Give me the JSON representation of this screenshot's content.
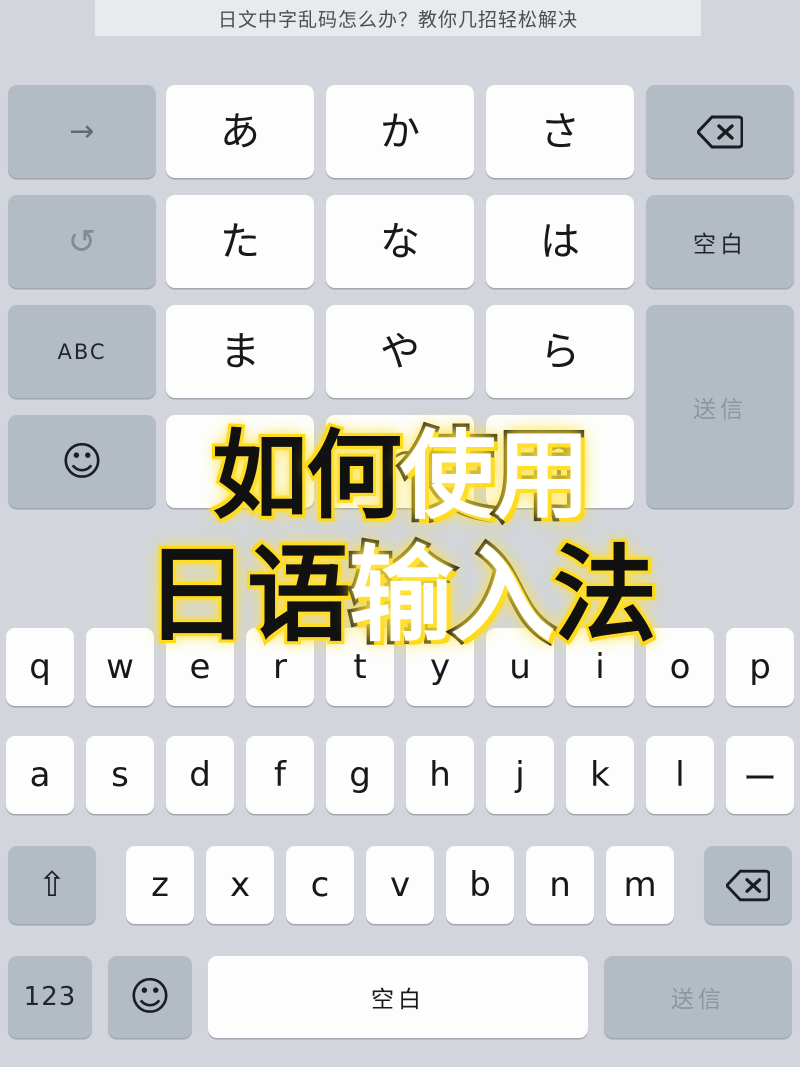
{
  "header": {
    "title": "日文中字乱码怎么办？教你几招轻松解决"
  },
  "overlay_art": {
    "line1": [
      {
        "char": "如",
        "style": "black"
      },
      {
        "char": "何",
        "style": "black"
      },
      {
        "char": "使",
        "style": "white"
      },
      {
        "char": "用",
        "style": "white"
      }
    ],
    "line2": [
      {
        "char": "日",
        "style": "black"
      },
      {
        "char": "语",
        "style": "black"
      },
      {
        "char": "输",
        "style": "white"
      },
      {
        "char": "入",
        "style": "white"
      },
      {
        "char": "法",
        "style": "black"
      }
    ],
    "glow_color": "#ffd400",
    "fill_black": "#111111",
    "fill_white": "#ffffff"
  },
  "kana_keyboard": {
    "left_column": [
      {
        "name": "arrow-right-key",
        "label": "→",
        "type": "gray"
      },
      {
        "name": "undo-key",
        "label": "↺",
        "type": "gray"
      },
      {
        "name": "abc-mode-key",
        "label": "ABC",
        "type": "gray"
      },
      {
        "name": "emoji-key",
        "label": "☺",
        "type": "gray"
      }
    ],
    "kana_grid": [
      [
        "あ",
        "か",
        "さ"
      ],
      [
        "た",
        "な",
        "は"
      ],
      [
        "ま",
        "や",
        "ら"
      ],
      [
        "、",
        "わ",
        "?"
      ]
    ],
    "right_column": [
      {
        "name": "delete-key",
        "label": "⌫",
        "type": "gray"
      },
      {
        "name": "space-key",
        "label": "空白",
        "type": "gray"
      },
      {
        "name": "send-key",
        "label": "送信",
        "type": "gray-disabled"
      }
    ]
  },
  "qwerty_keyboard": {
    "row1": [
      "q",
      "w",
      "e",
      "r",
      "t",
      "y",
      "u",
      "i",
      "o",
      "p"
    ],
    "row2": [
      "a",
      "s",
      "d",
      "f",
      "g",
      "h",
      "j",
      "k",
      "l",
      "ー"
    ],
    "row3": [
      "z",
      "x",
      "c",
      "v",
      "b",
      "n",
      "m"
    ],
    "shift_label": "⇧",
    "delete_label": "⌫",
    "bottom_row": {
      "numeric_label": "123",
      "emoji_label": "☺",
      "space_label": "空白",
      "send_label": "送信"
    }
  },
  "colors": {
    "background": "#d2d5dc",
    "key_white": "#fdfdfd",
    "key_gray": "#b3bcc5",
    "header_band": "#e9eaec",
    "text_dark": "#18181a",
    "text_disabled": "#8d959e"
  }
}
